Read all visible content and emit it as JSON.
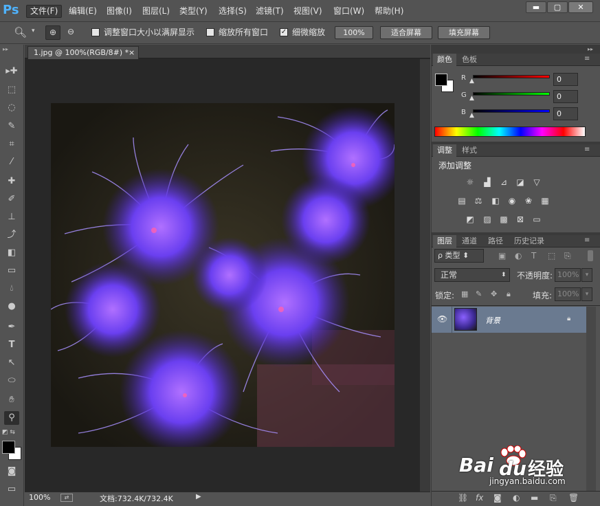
{
  "app": {
    "logo": "Ps",
    "menus": [
      "文件(F)",
      "编辑(E)",
      "图像(I)",
      "图层(L)",
      "类型(Y)",
      "选择(S)",
      "滤镜(T)",
      "视图(V)",
      "窗口(W)",
      "帮助(H)"
    ],
    "window_buttons": {
      "minimize": "▬",
      "maximize": "▢",
      "close": "✕"
    }
  },
  "options": {
    "resize_windows": "调整窗口大小以满屏显示",
    "resize_windows_checked": false,
    "zoom_all": "缩放所有窗口",
    "zoom_all_checked": false,
    "scrubby": "细微缩放",
    "scrubby_checked": true,
    "scrubby_mark": "✓",
    "btn_100": "100%",
    "btn_fit": "适合屏幕",
    "btn_fill": "填充屏幕"
  },
  "document": {
    "tab_title": "1.jpg @ 100%(RGB/8#) *",
    "tab_close": "×"
  },
  "status": {
    "zoom": "100%",
    "doc_info": "文档:732.4K/732.4K"
  },
  "color_panel": {
    "tabs": [
      "颜色",
      "色板"
    ],
    "channels": [
      {
        "label": "R",
        "value": "0"
      },
      {
        "label": "G",
        "value": "0"
      },
      {
        "label": "B",
        "value": "0"
      }
    ]
  },
  "adjust_panel": {
    "tabs": [
      "调整",
      "样式"
    ],
    "title": "添加调整"
  },
  "layers_panel": {
    "tabs": [
      "图层",
      "通道",
      "路径",
      "历史记录"
    ],
    "filter_type": "ρ 类型",
    "blend_mode": "正常",
    "opacity_label": "不透明度:",
    "opacity_value": "100%",
    "lock_label": "锁定:",
    "fill_label": "填充:",
    "fill_value": "100%",
    "layer": {
      "name": "背景"
    }
  },
  "watermark": {
    "brand": "Bai",
    "brand2": "du",
    "suffix": "经验",
    "url": "jingyan.baidu.com"
  },
  "colors": {
    "accent": "#4fb3ff",
    "layer_selected": "#6a7a90"
  }
}
